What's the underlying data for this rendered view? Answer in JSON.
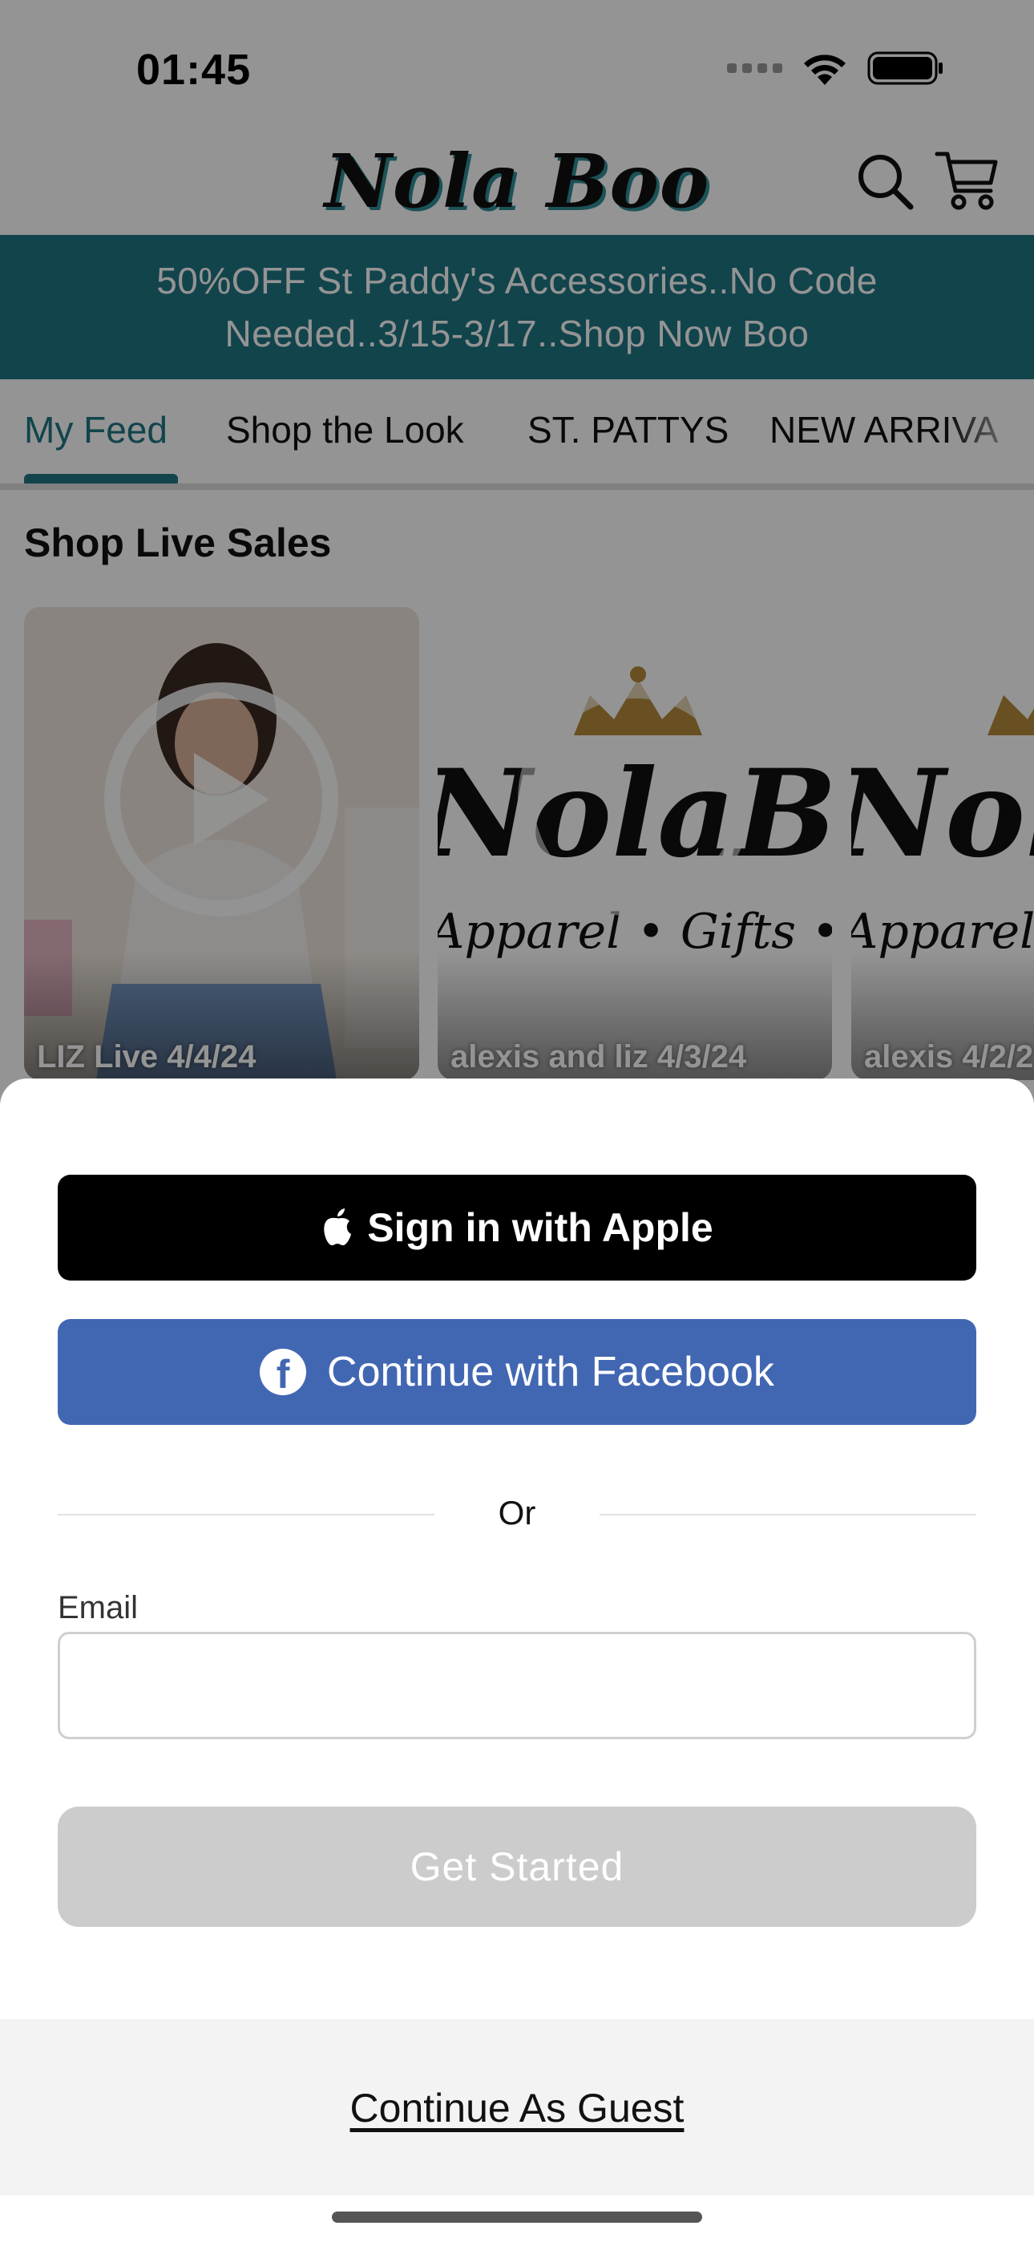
{
  "status_bar": {
    "time": "01:45",
    "icons": [
      "cellular-signal-icon",
      "wifi-icon",
      "battery-icon"
    ]
  },
  "header": {
    "logo_text": "Nola Boo",
    "icons": [
      "search-icon",
      "cart-icon"
    ]
  },
  "promo": {
    "line1": "50%OFF St Paddy's Accessories..No Code",
    "line2": "Needed..3/15-3/17..Shop Now Boo"
  },
  "tabs": [
    {
      "label": "My Feed",
      "active": true
    },
    {
      "label": "Shop the Look",
      "active": false
    },
    {
      "label": "ST. PATTYS",
      "active": false
    },
    {
      "label": "NEW ARRIVA",
      "active": false
    }
  ],
  "live_sales": {
    "title": "Shop Live Sales",
    "cards": [
      {
        "label": "LIZ Live 4/4/24"
      },
      {
        "label": "alexis and liz 4/3/24"
      },
      {
        "label": "alexis 4/2/2"
      }
    ],
    "brand_script": "NolaBoo",
    "brand_sub": "Apparel • Gifts • Home"
  },
  "sheet": {
    "apple_button": "Sign in with Apple",
    "facebook_button": "Continue with Facebook",
    "divider": "Or",
    "email_label": "Email",
    "email_value": "",
    "email_placeholder": "",
    "get_started": "Get Started",
    "guest_link": "Continue As Guest"
  },
  "colors": {
    "brand_teal": "#207683",
    "facebook_blue": "#4267b2",
    "apple_black": "#000000",
    "disabled_gray": "#cccccc"
  }
}
